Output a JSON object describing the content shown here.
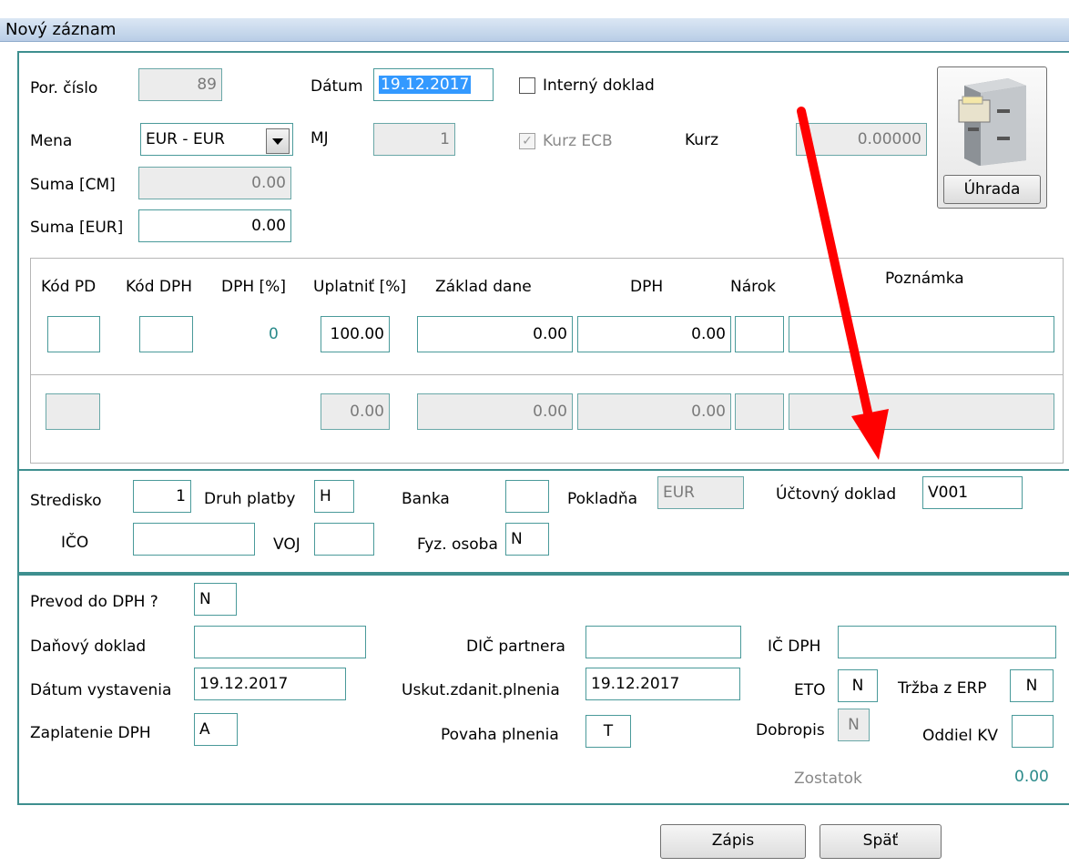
{
  "window": {
    "title": "Nový záznam"
  },
  "top": {
    "por_cislo_label": "Por. číslo",
    "por_cislo_value": "89",
    "datum_label": "Dátum",
    "datum_value": "19.12.2017",
    "interny_label": "Interný doklad",
    "mena_label": "Mena",
    "mena_value": "EUR - EUR",
    "mj_label": "MJ",
    "mj_value": "1",
    "kurz_ecb_label": "Kurz ECB",
    "kurz_label": "Kurz",
    "kurz_value": "0.00000",
    "suma_cm_label": "Suma [CM]",
    "suma_cm_value": "0.00",
    "suma_eur_label": "Suma [EUR]",
    "suma_eur_value": "0.00",
    "uhrada_button": "Úhrada"
  },
  "grid": {
    "headers": [
      "Kód PD",
      "Kód DPH",
      "DPH [%]",
      "Uplatniť [%]",
      "Základ dane",
      "DPH",
      "Nárok",
      "Poznámka"
    ],
    "row1": {
      "kod_pd": "",
      "kod_dph": "",
      "dph_pct": "0",
      "uplatnit": "100.00",
      "zaklad": "0.00",
      "dph": "0.00",
      "narok": "",
      "poznamka": ""
    },
    "row2": {
      "kod_pd": "",
      "uplatnit": "0.00",
      "zaklad": "0.00",
      "dph": "0.00",
      "narok": "",
      "poznamka": ""
    }
  },
  "mid": {
    "stredisko_label": "Stredisko",
    "stredisko_value": "1",
    "druh_platby_label": "Druh platby",
    "druh_platby_value": "H",
    "banka_label": "Banka",
    "banka_value": "",
    "pokladna_label": "Pokladňa",
    "pokladna_value": "EUR",
    "uctovny_label": "Účtovný doklad",
    "uctovny_value": "V001",
    "ico_label": "IČO",
    "ico_value": "",
    "voj_label": "VOJ",
    "voj_value": "",
    "fyz_osoba_label": "Fyz. osoba",
    "fyz_osoba_value": "N"
  },
  "dph": {
    "prevod_label": "Prevod do DPH ?",
    "prevod_value": "N",
    "danovy_label": "Daňový doklad",
    "danovy_value": "",
    "dic_label": "DIČ partnera",
    "dic_value": "",
    "ic_dph_label": "IČ DPH",
    "ic_dph_value": "",
    "datum_vyst_label": "Dátum vystavenia",
    "datum_vyst_value": "19.12.2017",
    "uskut_label": "Uskut.zdanit.plnenia",
    "uskut_value": "19.12.2017",
    "eto_label": "ETO",
    "eto_value": "N",
    "trzba_label": "Tržba z ERP",
    "trzba_value": "N",
    "zaplatenie_label": "Zaplatenie DPH",
    "zaplatenie_value": "A",
    "povaha_label": "Povaha plnenia",
    "povaha_value": "T",
    "dobropis_label": "Dobropis",
    "dobropis_value": "N",
    "oddiel_label": "Oddiel KV",
    "oddiel_value": "",
    "zostatok_label": "Zostatok",
    "zostatok_value": "0.00"
  },
  "footer": {
    "zapis_button": "Zápis",
    "spat_button": "Späť"
  },
  "colors": {
    "border": "#3e8f8f",
    "arrow": "#ff0000",
    "selection": "#3399ff"
  }
}
